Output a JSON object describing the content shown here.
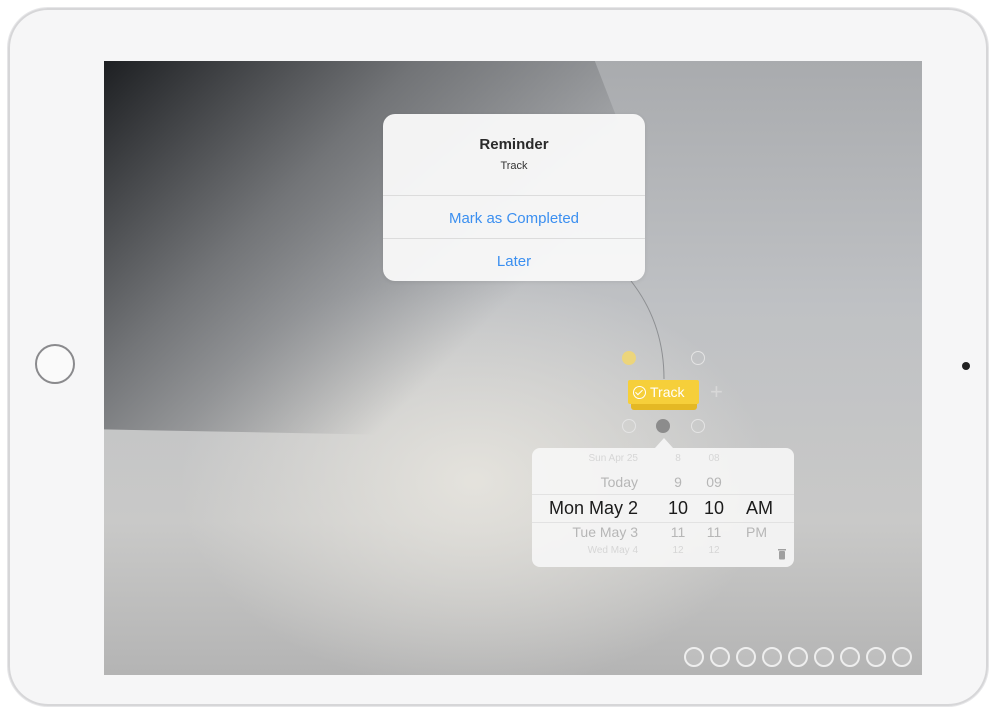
{
  "reminder_alert": {
    "title": "Reminder",
    "message": "Track",
    "buttons": {
      "complete": "Mark as Completed",
      "later": "Later"
    }
  },
  "mindmap": {
    "node_label": "Track",
    "add_symbol": "+"
  },
  "date_picker": {
    "rows": [
      {
        "date": "Sun Apr 25",
        "hour": "8",
        "minute": "08",
        "ampm": ""
      },
      {
        "date": "Today",
        "hour": "9",
        "minute": "09",
        "ampm": ""
      },
      {
        "date": "Mon May 2",
        "hour": "10",
        "minute": "10",
        "ampm": "AM"
      },
      {
        "date": "Tue May 3",
        "hour": "11",
        "minute": "11",
        "ampm": "PM"
      },
      {
        "date": "Wed May 4",
        "hour": "12",
        "minute": "12",
        "ampm": ""
      }
    ]
  },
  "colors": {
    "accent_blue": "#3b8ff0",
    "node_yellow": "#f6cf3a"
  },
  "toolbar": {
    "icons": [
      "filter-icon",
      "search-icon",
      "globe-icon",
      "copy-icon",
      "square-icon",
      "theme-icon",
      "share-icon",
      "settings-icon",
      "remove-icon"
    ]
  }
}
